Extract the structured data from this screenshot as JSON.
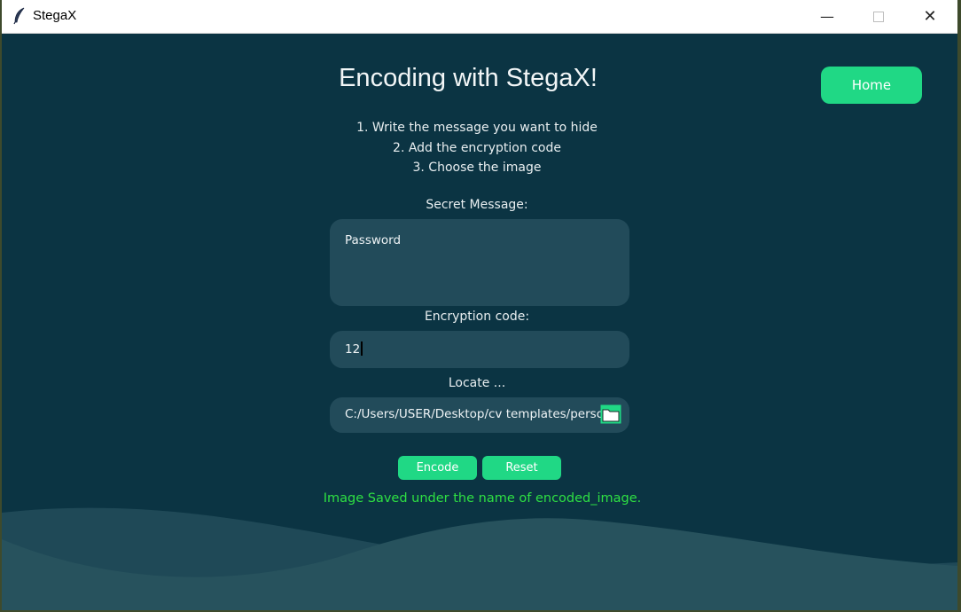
{
  "window": {
    "title": "StegaX",
    "controls": {
      "minimize": "—",
      "close": "✕"
    }
  },
  "page": {
    "heading": "Encoding with StegaX!",
    "home_label": "Home",
    "steps": [
      "1. Write the message you want to hide",
      "2. Add the encryption code",
      "3. Choose the image"
    ]
  },
  "secret": {
    "label": "Secret Message:",
    "value": "Password"
  },
  "encryption": {
    "label": "Encryption code:",
    "value": "12"
  },
  "locate": {
    "label": "Locate ...",
    "value": "C:/Users/USER/Desktop/cv templates/person",
    "folder_icon": "folder-icon"
  },
  "actions": {
    "encode_label": "Encode",
    "reset_label": "Reset"
  },
  "status": {
    "message": "Image Saved under the name of encoded_image."
  },
  "colors": {
    "background": "#0b3443",
    "field": "#224b5a",
    "accent": "#20d885",
    "success": "#2ee043",
    "wave": "#27525d"
  }
}
